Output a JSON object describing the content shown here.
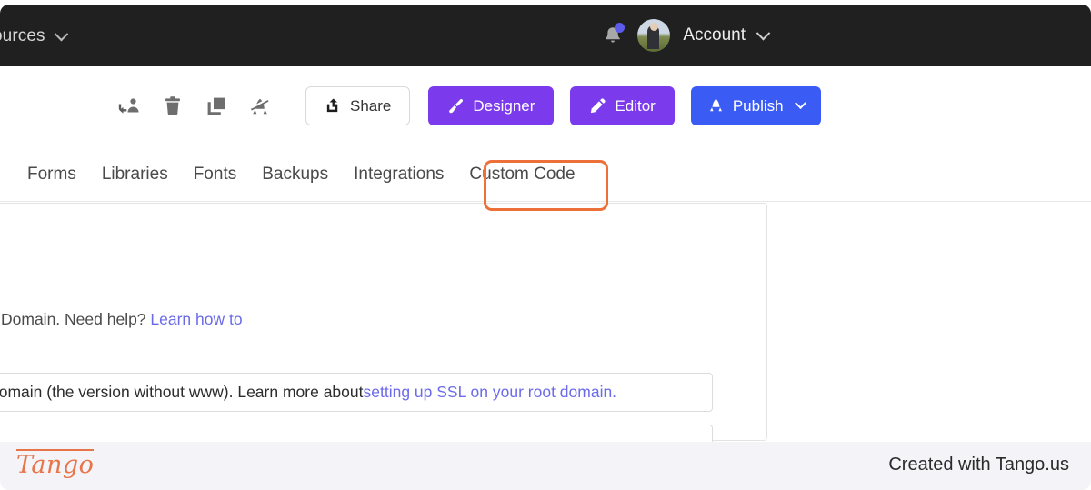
{
  "header": {
    "nav_label": "ources",
    "nav_chevron_icon": "chevron-down-icon",
    "notification_icon": "bell-icon",
    "notification_badge": "",
    "avatar_icon": "user-avatar",
    "account_label": "Account",
    "account_chevron_icon": "chevron-down-icon"
  },
  "toolbar": {
    "icons": [
      {
        "name": "transfer-site-icon",
        "title": "Transfer site"
      },
      {
        "name": "delete-icon",
        "title": "Delete site"
      },
      {
        "name": "duplicate-icon",
        "title": "Duplicate site"
      },
      {
        "name": "unpublish-icon",
        "title": "Unpublish site"
      }
    ],
    "share_label": "Share",
    "share_icon": "share-export-icon",
    "designer_label": "Designer",
    "designer_icon": "paintbrush-icon",
    "editor_label": "Editor",
    "editor_icon": "pencil-icon",
    "publish_label": "Publish",
    "publish_icon": "rocket-icon",
    "publish_chevron_icon": "chevron-down-icon"
  },
  "tabs": [
    {
      "label": "Forms",
      "active": false
    },
    {
      "label": "Libraries",
      "active": false
    },
    {
      "label": "Fonts",
      "active": false
    },
    {
      "label": "Backups",
      "active": false
    },
    {
      "label": "Integrations",
      "active": false
    },
    {
      "label": "Custom Code",
      "active": true
    }
  ],
  "main": {
    "helper_text": "Domain. Need help? ",
    "helper_link": "Learn how to",
    "info_text": "root domain (the version without www). Learn more about ",
    "info_link": "setting up SSL on your root domain."
  },
  "footer": {
    "logo_text": "Tango",
    "credit_text": "Created with Tango.us"
  },
  "colors": {
    "header_bg": "#202020",
    "accent_purple": "#7c3aed",
    "accent_blue": "#3b5bf5",
    "highlight_orange": "#ec7038",
    "link_blue": "#6b6bea",
    "badge_blue": "#5b5bec",
    "tango_orange": "#e8754a",
    "footer_bg": "#f4f3f7"
  }
}
